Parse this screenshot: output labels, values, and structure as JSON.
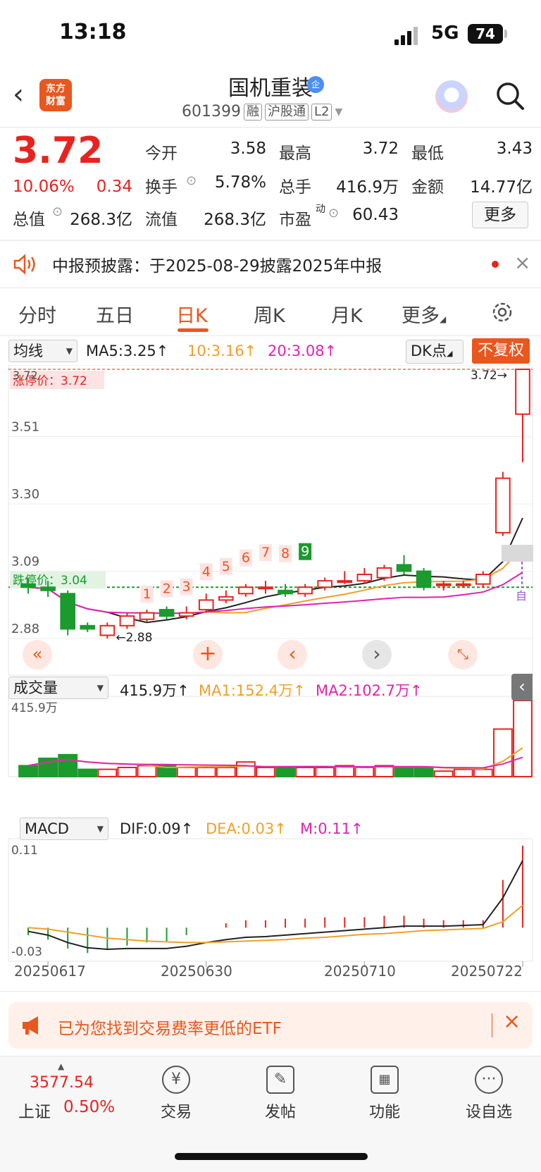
{
  "status_bar": {
    "time": "13:18",
    "network": "5G",
    "battery": "74"
  },
  "header": {
    "back_icon": "chevron-left-icon",
    "logo_text": "东方\n财富",
    "stock_name": "国机重装",
    "badge": "企",
    "code": "601399",
    "tags": [
      "融",
      "沪股通",
      "L2"
    ]
  },
  "quote": {
    "price": "3.72",
    "change_pct": "10.06%",
    "change_abs": "0.34",
    "open_label": "今开",
    "open": "3.58",
    "high_label": "最高",
    "high": "3.72",
    "low_label": "最低",
    "low": "3.43",
    "turnover_label": "换手",
    "turnover": "5.78%",
    "volume_label": "总手",
    "volume": "416.9万",
    "amount_label": "金额",
    "amount": "14.77亿",
    "total_mv_label": "总值",
    "total_mv": "268.3亿",
    "float_mv_label": "流值",
    "float_mv": "268.3亿",
    "pe_label": "市盈",
    "pe_sup": "动",
    "pe": "60.43",
    "more_label": "更多"
  },
  "notice": {
    "text": "中报预披露：于2025-08-29披露2025年中报"
  },
  "tabs": [
    "分时",
    "五日",
    "日K",
    "周K",
    "月K",
    "更多"
  ],
  "active_tab": "日K",
  "kline": {
    "ma_select": "均线",
    "ma5": "MA5:3.25↑",
    "ma10": "10:3.16↑",
    "ma20": "20:3.08↑",
    "dk_label": "DK点",
    "adjust_label": "不复权",
    "limit_up_label": "涨停价：3.72",
    "limit_down_label": "跌停价：3.04",
    "max_marker": "3.72→",
    "min_marker": "←2.88",
    "y_ticks": [
      "3.72",
      "3.51",
      "3.30",
      "3.09",
      "2.88"
    ],
    "sequence_numbers": [
      "1",
      "2",
      "3",
      "4",
      "5",
      "6",
      "7",
      "8",
      "9"
    ],
    "self_select_marker": "自"
  },
  "volume_panel": {
    "select": "成交量",
    "vol": "415.9万↑",
    "ma1": "MA1:152.4万↑",
    "ma2": "MA2:102.7万↑",
    "y_top": "415.9万"
  },
  "macd_panel": {
    "select": "MACD",
    "dif": "DIF:0.09↑",
    "dea": "DEA:0.03↑",
    "m": "M:0.11↑",
    "y_top": "0.11",
    "y_bottom": "-0.03"
  },
  "x_axis": [
    "20250617",
    "20250630",
    "20250710",
    "20250722"
  ],
  "etf_banner": {
    "text": "已为您找到交易费率更低的ETF"
  },
  "bottom_nav": {
    "index_value": "3577.54",
    "index_name": "上证",
    "index_pct": "0.50%",
    "items": [
      "交易",
      "发帖",
      "功能",
      "设自选"
    ]
  },
  "colors": {
    "up": "#e8231f",
    "down": "#1b9a2e",
    "accent": "#e8571e",
    "ma10": "#f0a028",
    "ma20": "#e023b0"
  },
  "chart_data": {
    "type": "candlestick",
    "price_range": [
      2.88,
      3.72
    ],
    "candles": [
      {
        "o": 3.05,
        "c": 3.04,
        "h": 3.07,
        "l": 3.02
      },
      {
        "o": 3.04,
        "c": 3.03,
        "h": 3.06,
        "l": 3.01
      },
      {
        "o": 3.02,
        "c": 2.91,
        "h": 3.03,
        "l": 2.89
      },
      {
        "o": 2.92,
        "c": 2.91,
        "h": 2.93,
        "l": 2.9
      },
      {
        "o": 2.89,
        "c": 2.92,
        "h": 2.93,
        "l": 2.88
      },
      {
        "o": 2.92,
        "c": 2.95,
        "h": 2.96,
        "l": 2.91
      },
      {
        "o": 2.94,
        "c": 2.96,
        "h": 2.97,
        "l": 2.93
      },
      {
        "o": 2.97,
        "c": 2.95,
        "h": 2.98,
        "l": 2.94
      },
      {
        "o": 2.95,
        "c": 2.96,
        "h": 2.98,
        "l": 2.94
      },
      {
        "o": 2.97,
        "c": 3.0,
        "h": 3.02,
        "l": 2.96
      },
      {
        "o": 3.0,
        "c": 3.01,
        "h": 3.03,
        "l": 2.99
      },
      {
        "o": 3.02,
        "c": 3.04,
        "h": 3.05,
        "l": 3.01
      },
      {
        "o": 3.04,
        "c": 3.04,
        "h": 3.06,
        "l": 3.02
      },
      {
        "o": 3.03,
        "c": 3.02,
        "h": 3.05,
        "l": 3.01
      },
      {
        "o": 3.02,
        "c": 3.04,
        "h": 3.05,
        "l": 3.01
      },
      {
        "o": 3.04,
        "c": 3.06,
        "h": 3.07,
        "l": 3.03
      },
      {
        "o": 3.06,
        "c": 3.06,
        "h": 3.09,
        "l": 3.05
      },
      {
        "o": 3.06,
        "c": 3.08,
        "h": 3.1,
        "l": 3.05
      },
      {
        "o": 3.07,
        "c": 3.1,
        "h": 3.11,
        "l": 3.06
      },
      {
        "o": 3.11,
        "c": 3.09,
        "h": 3.14,
        "l": 3.08
      },
      {
        "o": 3.09,
        "c": 3.04,
        "h": 3.1,
        "l": 3.03
      },
      {
        "o": 3.05,
        "c": 3.05,
        "h": 3.06,
        "l": 3.03
      },
      {
        "o": 3.05,
        "c": 3.05,
        "h": 3.06,
        "l": 3.04
      },
      {
        "o": 3.05,
        "c": 3.08,
        "h": 3.09,
        "l": 3.04
      },
      {
        "o": 3.21,
        "c": 3.38,
        "h": 3.4,
        "l": 3.2
      },
      {
        "o": 3.58,
        "c": 3.72,
        "h": 3.72,
        "l": 3.43
      }
    ],
    "volumes": [
      0.6,
      1.0,
      1.2,
      0.4,
      0.4,
      0.5,
      0.6,
      0.6,
      0.5,
      0.5,
      0.5,
      0.8,
      0.5,
      0.5,
      0.5,
      0.5,
      0.6,
      0.5,
      0.6,
      0.5,
      0.5,
      0.3,
      0.4,
      0.4,
      2.6,
      4.159
    ],
    "macd_dif": [
      -0.005,
      -0.01,
      -0.02,
      -0.027,
      -0.029,
      -0.028,
      -0.028,
      -0.028,
      -0.025,
      -0.02,
      -0.016,
      -0.013,
      -0.012,
      -0.01,
      -0.008,
      -0.006,
      -0.004,
      -0.002,
      0.0,
      0.002,
      0.002,
      0.002,
      0.003,
      0.004,
      0.04,
      0.09
    ],
    "macd_dea": [
      -0.0,
      -0.002,
      -0.006,
      -0.01,
      -0.014,
      -0.016,
      -0.018,
      -0.019,
      -0.02,
      -0.02,
      -0.019,
      -0.018,
      -0.017,
      -0.016,
      -0.014,
      -0.013,
      -0.011,
      -0.009,
      -0.008,
      -0.006,
      -0.004,
      -0.003,
      -0.002,
      -0.001,
      0.008,
      0.03
    ],
    "macd_hist": [
      -0.01,
      -0.016,
      -0.028,
      -0.034,
      -0.03,
      -0.024,
      -0.02,
      -0.018,
      -0.01,
      0.0,
      0.006,
      0.01,
      0.01,
      0.012,
      0.012,
      0.014,
      0.014,
      0.014,
      0.016,
      0.016,
      0.012,
      0.01,
      0.01,
      0.01,
      0.064,
      0.11
    ],
    "macd_range": [
      -0.03,
      0.11
    ]
  }
}
